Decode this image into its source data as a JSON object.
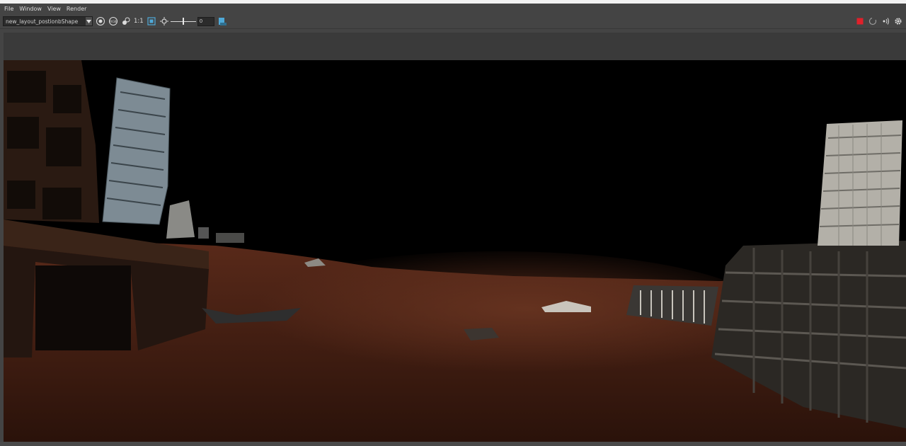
{
  "menu": {
    "items": [
      "File",
      "Window",
      "View",
      "Render"
    ]
  },
  "toolbar": {
    "camera_select": "new_layout_postionbShape",
    "ratio_label": "1:1",
    "exposure_value": "0",
    "exposure_level": 0.5,
    "icons": [
      "snapshot-icon",
      "rgb-channel-icon",
      "color-correct-icon",
      "frame-region-icon",
      "exposure-icon",
      "image-settings-icon"
    ]
  },
  "status": {
    "icons": [
      "stop-render-icon",
      "refresh-icon",
      "ipr-icon",
      "settings-icon"
    ],
    "stop_color": "#e0202a"
  },
  "render": {
    "sky_color": "#000000",
    "ground_color": "#5a2a1a"
  }
}
